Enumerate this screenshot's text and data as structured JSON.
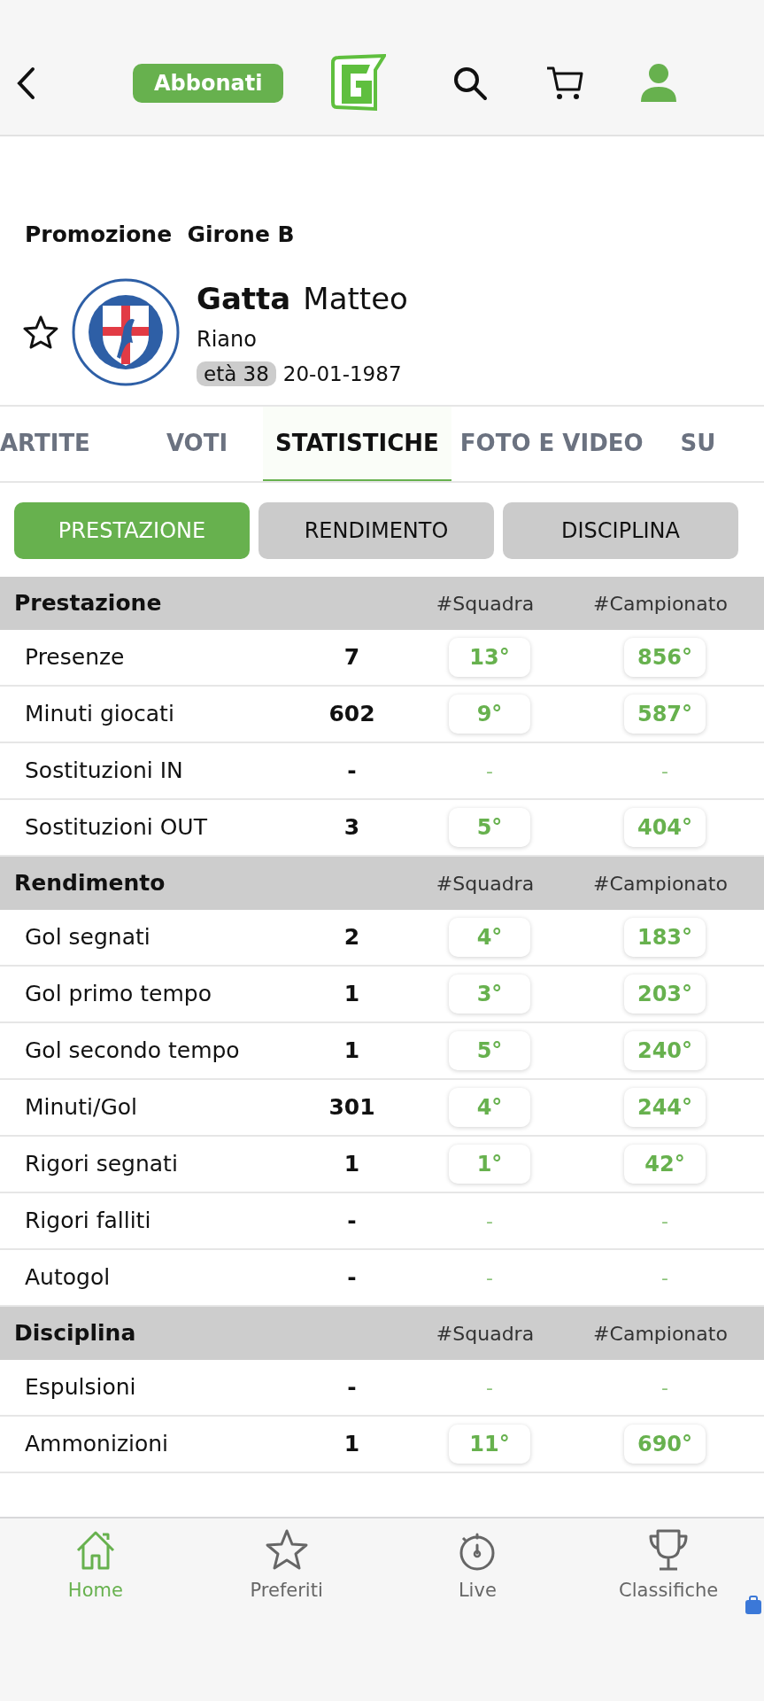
{
  "header": {
    "subscribe_button": "Abbonati"
  },
  "competition": {
    "title": "Promozione",
    "group": "Girone B"
  },
  "player": {
    "surname": "Gatta",
    "name": "Matteo",
    "team": "Riano",
    "age_badge": "età 38",
    "birth_date": "20-01-1987",
    "favorite": false
  },
  "tabs": [
    {
      "label": "ARTITE",
      "selected": false
    },
    {
      "label": "VOTI",
      "selected": false
    },
    {
      "label": "STATISTICHE",
      "selected": true
    },
    {
      "label": "FOTO E VIDEO",
      "selected": false
    },
    {
      "label": "SU",
      "selected": false
    }
  ],
  "filters": [
    {
      "label": "PRESTAZIONE",
      "selected": true
    },
    {
      "label": "RENDIMENTO",
      "selected": false
    },
    {
      "label": "DISCIPLINA",
      "selected": false
    }
  ],
  "sections": [
    {
      "title": "Prestazione",
      "columns": [
        "#Squadra",
        "#Campionato"
      ],
      "rows": [
        {
          "label": "Presenze",
          "value": "7",
          "team_rank": "13°",
          "league_rank": "856°",
          "ranked": true
        },
        {
          "label": "Minuti giocati",
          "value": "602",
          "team_rank": "9°",
          "league_rank": "587°",
          "ranked": true
        },
        {
          "label": "Sostituzioni IN",
          "value": "-",
          "team_rank": "-",
          "league_rank": "-",
          "ranked": false
        },
        {
          "label": "Sostituzioni OUT",
          "value": "3",
          "team_rank": "5°",
          "league_rank": "404°",
          "ranked": true
        }
      ]
    },
    {
      "title": "Rendimento",
      "columns": [
        "#Squadra",
        "#Campionato"
      ],
      "rows": [
        {
          "label": "Gol segnati",
          "value": "2",
          "team_rank": "4°",
          "league_rank": "183°",
          "ranked": true
        },
        {
          "label": "Gol primo tempo",
          "value": "1",
          "team_rank": "3°",
          "league_rank": "203°",
          "ranked": true
        },
        {
          "label": "Gol secondo tempo",
          "value": "1",
          "team_rank": "5°",
          "league_rank": "240°",
          "ranked": true
        },
        {
          "label": "Minuti/Gol",
          "value": "301",
          "team_rank": "4°",
          "league_rank": "244°",
          "ranked": true
        },
        {
          "label": "Rigori segnati",
          "value": "1",
          "team_rank": "1°",
          "league_rank": "42°",
          "ranked": true
        },
        {
          "label": "Rigori falliti",
          "value": "-",
          "team_rank": "-",
          "league_rank": "-",
          "ranked": false
        },
        {
          "label": "Autogol",
          "value": "-",
          "team_rank": "-",
          "league_rank": "-",
          "ranked": false
        }
      ]
    },
    {
      "title": "Disciplina",
      "columns": [
        "#Squadra",
        "#Campionato"
      ],
      "rows": [
        {
          "label": "Espulsioni",
          "value": "-",
          "team_rank": "-",
          "league_rank": "-",
          "ranked": false
        },
        {
          "label": "Ammonizioni",
          "value": "1",
          "team_rank": "11°",
          "league_rank": "690°",
          "ranked": true
        }
      ]
    }
  ],
  "bottom_nav": [
    {
      "label": "Home",
      "selected": true
    },
    {
      "label": "Preferiti",
      "selected": false
    },
    {
      "label": "Live",
      "selected": false
    },
    {
      "label": "Classifiche",
      "selected": false
    }
  ]
}
